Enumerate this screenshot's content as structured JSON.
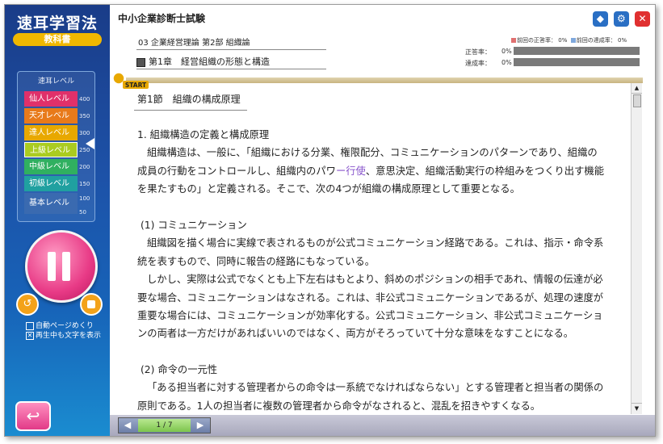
{
  "app": {
    "title": "速耳学習法",
    "subtitle": "教科書"
  },
  "header": {
    "exam_title": "中小企業診断士試験",
    "breadcrumb": "03 企業経営理論 第2部 組織論",
    "chapter": "第1章　経営組織の形態と構造",
    "legend": {
      "prev_correct_label": "前回の正答率：",
      "prev_correct_value": "0%",
      "prev_achieve_label": "前回の達成率：",
      "prev_achieve_value": "0%",
      "correct_color": "#e07070",
      "achieve_color": "#7fa8dc"
    },
    "stats": {
      "correct_label": "正答率：",
      "correct_value": "0%",
      "correct_fraction": 0,
      "achieve_label": "達成率：",
      "achieve_value": "0%",
      "achieve_fraction": 0
    },
    "controls": [
      {
        "name": "cube-button",
        "icon": "cube-icon",
        "color": "#2a6fc4"
      },
      {
        "name": "settings-button",
        "icon": "gear-icon",
        "color": "#2a6fc4"
      },
      {
        "name": "close-button",
        "icon": "close-icon",
        "color": "#e03030"
      }
    ]
  },
  "sidebar": {
    "level_panel_title": "速耳レベル",
    "levels": [
      {
        "label": "仙人レベル",
        "color": "#e0306a",
        "num": "400"
      },
      {
        "label": "天才レベル",
        "color": "#e87a1a",
        "num": "350"
      },
      {
        "label": "達人レベル",
        "color": "#e8a800",
        "num": "300"
      },
      {
        "label": "上級レベル",
        "color": "#aacc20",
        "num": "250"
      },
      {
        "label": "中級レベル",
        "color": "#30b060",
        "num": "200"
      },
      {
        "label": "初級レベル",
        "color": "#20a0a0",
        "num": "150"
      },
      {
        "label": "基本レベル",
        "color": "#3a6ab0",
        "num": "100"
      }
    ],
    "level_num_extra": "50",
    "current_level": "上級レベル",
    "options": [
      {
        "label": "自動ページめくり",
        "checked": false
      },
      {
        "label": "再生中も文字を表示",
        "checked": true
      }
    ],
    "start_marker": "START"
  },
  "content": {
    "section_title": "第1節　組織の構成原理",
    "paragraphs": [
      "1. 組織構造の定義と構成原理",
      "組織構造は、一般に、「組織における分業、権限配分、コミュニケーションのパターンであり、組織の",
      "成員の行動をコントロールし、組織内のパワ",
      "ー行使",
      "、意思決定、組織活動実行の枠組みをつくり出す機能",
      "を果たすもの」と定義される。そこで、次の4つが組織の構成原理として重要となる。",
      "(1) コミュニケーション",
      "組織図を描く場合に実線で表されるものが公式コミュニケーション経路である。これは、指示・命令系",
      "統を表すもので、同時に報告の経路にもなっている。",
      "しかし、実際は公式でなくとも上下左右はもとより、斜めのポジションの相手であれ、情報の伝達が必",
      "要な場合、コミュニケーションはなされる。これは、非公式コミュニケーションであるが、処理の速度が",
      "重要な場合には、コミュニケーションが効率化する。公式コミュニケーション、非公式コミュニケーショ",
      "ンの両者は一方だけがあればいいのではなく、両方がそろっていて十分な意味をなすことになる。",
      "(2) 命令の一元性",
      "「ある担当者に対する管理者からの命令は一系統でなければならない」とする管理者と担当者の関係の",
      "原則である。1人の担当者に複数の管理者から命令がなされると、混乱を招きやすくなる。"
    ]
  },
  "footer": {
    "page_indicator": "1 / 7"
  }
}
